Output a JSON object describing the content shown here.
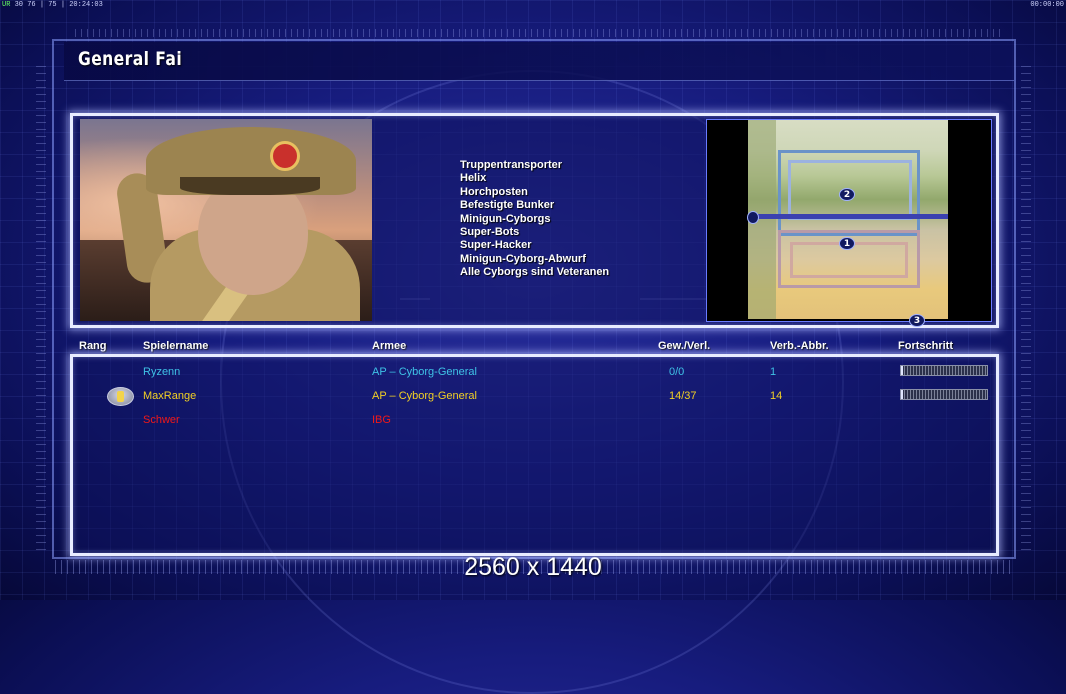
{
  "status_bar": {
    "left_prefix": "UR",
    "left_stats": "30 76 | 75 | 20:24:03",
    "right_time": "00:00:00"
  },
  "title": "General Fai",
  "units": [
    "Truppentransporter",
    "Helix",
    "Horchposten",
    "Befestigte Bunker",
    "Minigun-Cyborgs",
    "Super-Bots",
    "Super-Hacker",
    "Minigun-Cyborg-Abwurf",
    "Alle Cyborgs sind Veteranen"
  ],
  "minimap": {
    "markers": [
      "2",
      "1",
      "3"
    ]
  },
  "table": {
    "headers": {
      "rank": "Rang",
      "player": "Spielername",
      "army": "Armee",
      "winloss": "Gew./Verl.",
      "disconnects": "Verb.-Abbr.",
      "progress": "Fortschritt"
    },
    "rows": [
      {
        "name": "Ryzenn",
        "army": "AP – Cyborg-General",
        "winloss": "0/0",
        "disconnects": "1",
        "color": "#3fc2e6",
        "progress": 0.0,
        "rank_icon": false
      },
      {
        "name": "MaxRange",
        "army": "AP – Cyborg-General",
        "winloss": "14/37",
        "disconnects": "14",
        "color": "#f2d024",
        "progress": 0.0,
        "rank_icon": true
      },
      {
        "name": "Schwer",
        "army": "IBG",
        "winloss": "",
        "disconnects": "",
        "color": "#f01818",
        "progress": null,
        "rank_icon": false
      }
    ]
  },
  "resolution_label": "2560 x 1440"
}
